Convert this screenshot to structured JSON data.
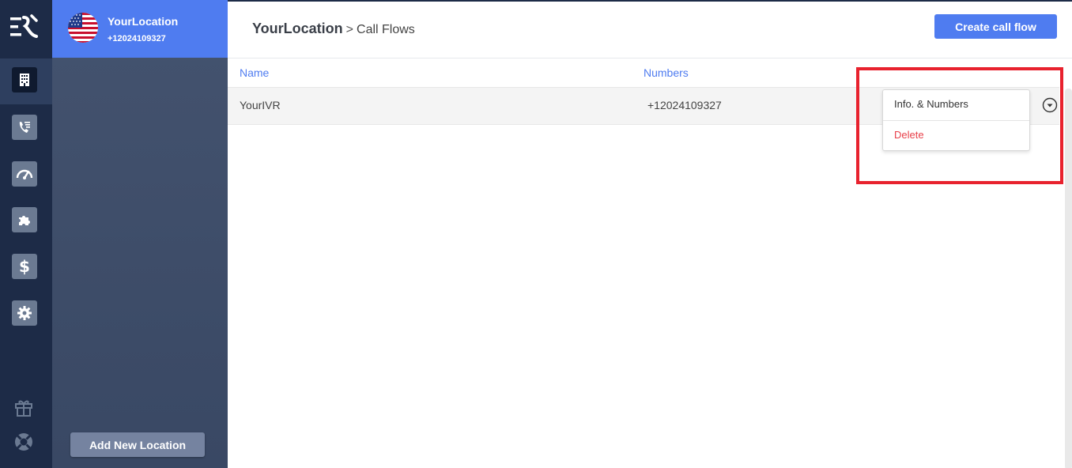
{
  "location": {
    "name": "YourLocation",
    "phone": "+12024109327",
    "add_button": "Add New Location"
  },
  "breadcrumb": {
    "root": "YourLocation",
    "separator": ">",
    "current": "Call Flows"
  },
  "toolbar": {
    "create_label": "Create call flow"
  },
  "table": {
    "columns": [
      "Name",
      "Numbers"
    ],
    "rows": [
      {
        "name": "YourIVR",
        "number": "+12024109327"
      }
    ]
  },
  "dropdown": {
    "items": [
      "Info. & Numbers",
      "Delete"
    ]
  },
  "rail": {
    "icons": [
      "logo-icon",
      "building-icon",
      "call-list-icon",
      "speedometer-icon",
      "puzzle-icon",
      "dollar-icon",
      "gear-icon",
      "gift-icon",
      "lifebuoy-icon"
    ]
  },
  "colors": {
    "accent": "#4f7cf0",
    "rail": "#1d2b47",
    "panel": "#3f4e6a",
    "danger": "#e8404a",
    "highlight": "#e8222e"
  }
}
